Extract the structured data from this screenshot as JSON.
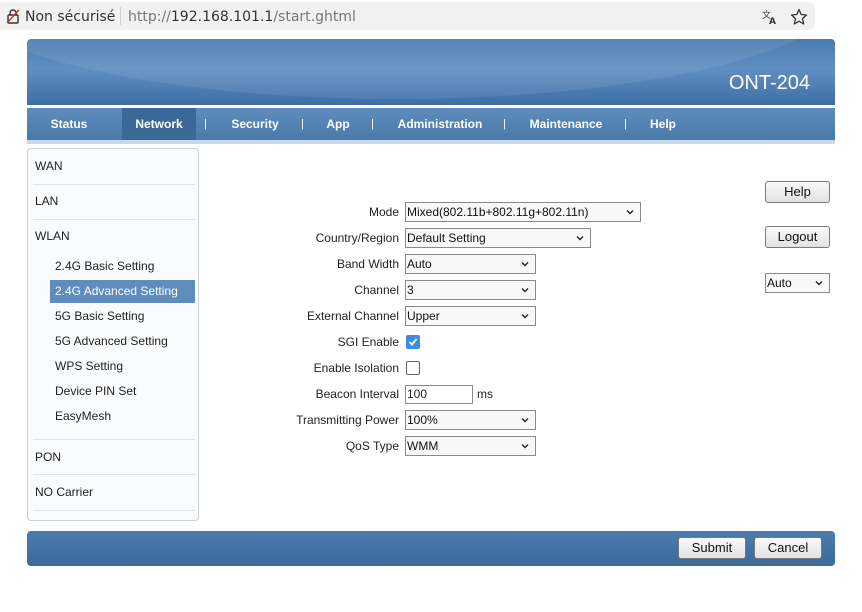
{
  "browser": {
    "security_label": "Non sécurisé",
    "url_prefix": "http://",
    "url_host": "192.168.101.1",
    "url_path": "/start.ghtml"
  },
  "header": {
    "model": "ONT-204"
  },
  "nav": {
    "items": [
      "Status",
      "Network",
      "Security",
      "App",
      "Administration",
      "Maintenance",
      "Help"
    ],
    "active": "Network",
    "separator": "|"
  },
  "sidebar": {
    "sections": [
      "WAN",
      "LAN",
      "WLAN",
      "PON",
      "NO Carrier"
    ],
    "wlan_items": [
      "2.4G Basic Setting",
      "2.4G Advanced Setting",
      "5G Basic Setting",
      "5G Advanced Setting",
      "WPS Setting",
      "Device PIN Set",
      "EasyMesh"
    ],
    "active": "2.4G Advanced Setting"
  },
  "form": {
    "mode": {
      "label": "Mode",
      "value": "Mixed(802.11b+802.11g+802.11n)"
    },
    "country": {
      "label": "Country/Region",
      "value": "Default Setting"
    },
    "bandwidth": {
      "label": "Band Width",
      "value": "Auto"
    },
    "channel": {
      "label": "Channel",
      "value": "3"
    },
    "ext_channel": {
      "label": "External Channel",
      "value": "Upper"
    },
    "sgi": {
      "label": "SGI Enable",
      "checked": true
    },
    "isolation": {
      "label": "Enable Isolation",
      "checked": false
    },
    "beacon": {
      "label": "Beacon Interval",
      "value": "100",
      "unit": "ms"
    },
    "power": {
      "label": "Transmitting Power",
      "value": "100%"
    },
    "qos": {
      "label": "QoS Type",
      "value": "WMM"
    }
  },
  "right_panel": {
    "help_label": "Help",
    "logout_label": "Logout",
    "language_value": "Auto"
  },
  "footer": {
    "submit_label": "Submit",
    "cancel_label": "Cancel"
  },
  "colors": {
    "accent": "#4a79ab",
    "active_nav": "#3a6898",
    "active_side": "#5d8cbd",
    "checkbox_on": "#3d8ee0"
  },
  "icons": [
    "insecure-lock-icon",
    "translate-icon",
    "star-icon",
    "chevron-down-icon"
  ]
}
